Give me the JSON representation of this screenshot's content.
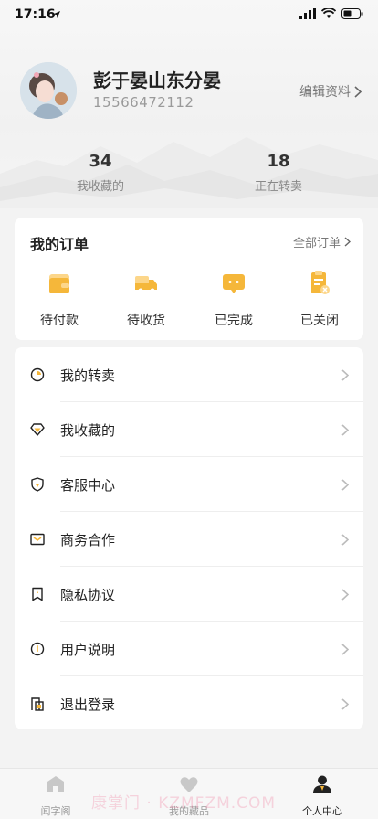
{
  "status_bar": {
    "time": "17:16"
  },
  "profile": {
    "username": "彭于晏山东分晏",
    "phone": "15566472112",
    "edit_label": "编辑资料"
  },
  "stats": [
    {
      "value": "34",
      "label": "我收藏的"
    },
    {
      "value": "18",
      "label": "正在转卖"
    }
  ],
  "orders": {
    "title": "我的订单",
    "all_label": "全部订单",
    "items": [
      {
        "label": "待付款",
        "icon": "wallet-icon"
      },
      {
        "label": "待收货",
        "icon": "delivery-truck-icon"
      },
      {
        "label": "已完成",
        "icon": "chat-bubble-icon"
      },
      {
        "label": "已关闭",
        "icon": "closed-document-icon"
      }
    ]
  },
  "menu": [
    {
      "label": "我的转卖",
      "icon": "resale-icon"
    },
    {
      "label": "我收藏的",
      "icon": "diamond-icon"
    },
    {
      "label": "客服中心",
      "icon": "shield-icon"
    },
    {
      "label": "商务合作",
      "icon": "envelope-icon"
    },
    {
      "label": "隐私协议",
      "icon": "bookmark-icon"
    },
    {
      "label": "用户说明",
      "icon": "info-icon"
    },
    {
      "label": "退出登录",
      "icon": "logout-icon"
    }
  ],
  "tabbar": [
    {
      "label": "闻字阁",
      "icon": "home-icon",
      "active": false
    },
    {
      "label": "我的藏品",
      "icon": "heart-icon",
      "active": false
    },
    {
      "label": "个人中心",
      "icon": "person-icon",
      "active": true
    }
  ],
  "watermark": "康掌门 · KZMFZM.COM",
  "colors": {
    "accent": "#f5b73a",
    "accent_light": "#fcd68a",
    "text": "#222222",
    "muted": "#9a9a9a"
  }
}
